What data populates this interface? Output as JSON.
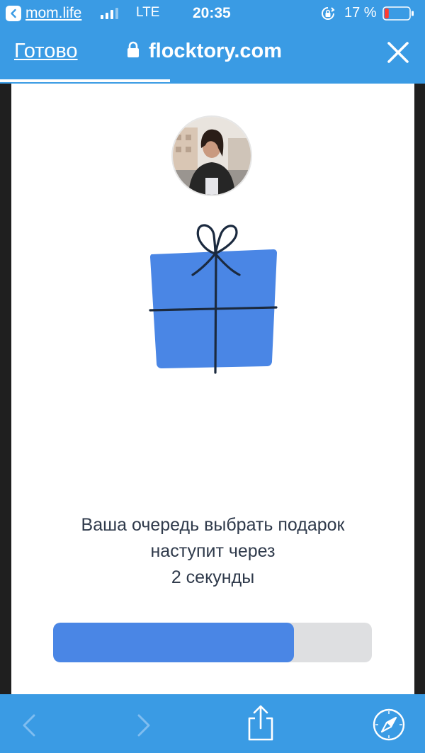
{
  "status_bar": {
    "back_app": "mom.life",
    "carrier": "LTE",
    "time": "20:35",
    "battery_percent": "17 %",
    "signal_bars_active": 3,
    "signal_bars_total": 4,
    "battery_level": 0.17,
    "battery_color": "#ff3b30"
  },
  "nav": {
    "done_label": "Готово",
    "url": "flocktory.com",
    "load_progress": 0.4
  },
  "page": {
    "message_line1": "Ваша очередь выбрать подарок",
    "message_line2": "наступит через",
    "message_line3": "2 секунды",
    "queue_progress": 0.755,
    "gift_color": "#4a86e5",
    "accent": "#3a9be4"
  },
  "toolbar": {
    "icons": [
      "back-icon",
      "forward-icon",
      "share-icon",
      "safari-compass-icon"
    ]
  }
}
